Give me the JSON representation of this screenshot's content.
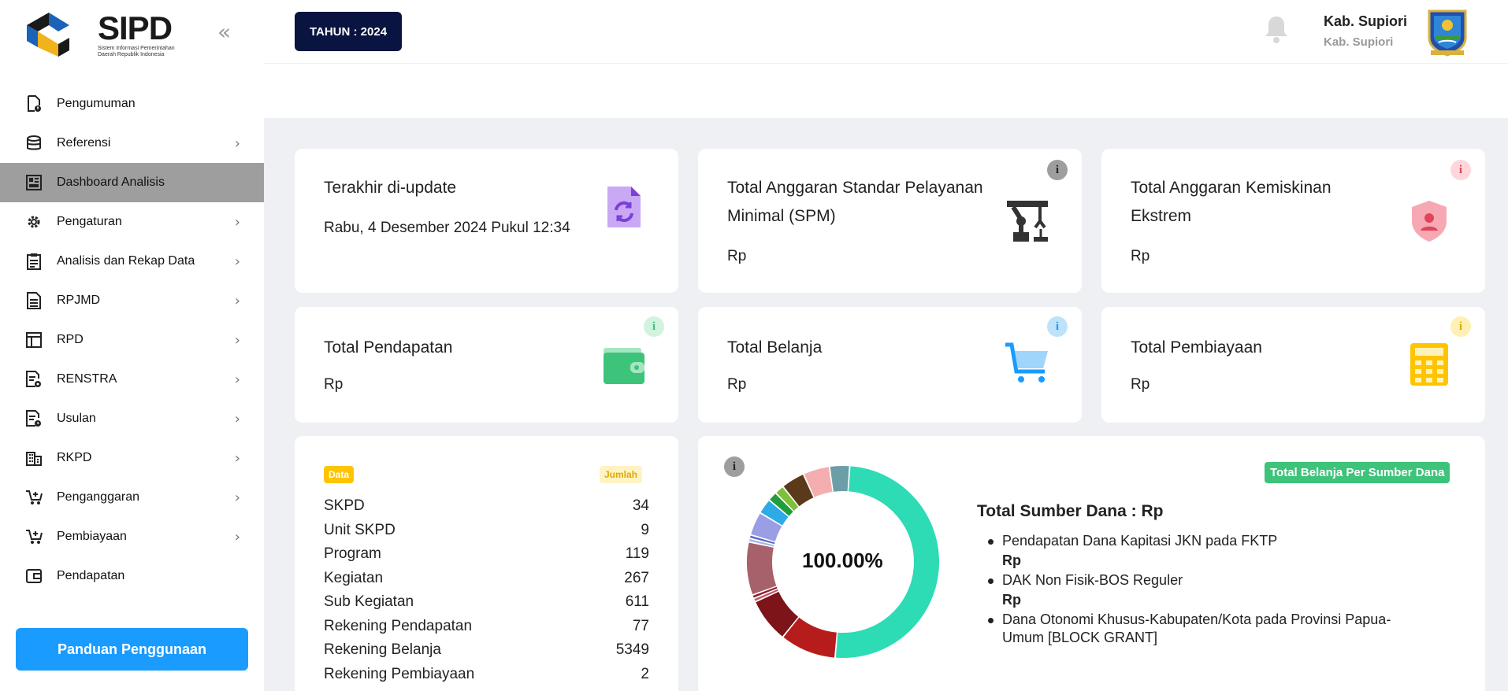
{
  "sidebar": {
    "logo_text": "SIPD",
    "logo_subtitle": "Sistem Informasi Pemerintahan Daerah Republik Indonesia",
    "items": [
      {
        "label": "Pengumuman",
        "icon": "announcement-icon",
        "has_children": false,
        "active": false
      },
      {
        "label": "Referensi",
        "icon": "database-icon",
        "has_children": true,
        "active": false
      },
      {
        "label": "Dashboard Analisis",
        "icon": "dashboard-icon",
        "has_children": false,
        "active": true
      },
      {
        "label": "Pengaturan",
        "icon": "gear-icon",
        "has_children": true,
        "active": false
      },
      {
        "label": "Analisis dan Rekap Data",
        "icon": "clipboard-icon",
        "has_children": true,
        "active": false
      },
      {
        "label": "RPJMD",
        "icon": "document-icon",
        "has_children": true,
        "active": false
      },
      {
        "label": "RPD",
        "icon": "table-icon",
        "has_children": true,
        "active": false
      },
      {
        "label": "RENSTRA",
        "icon": "doc-gear-icon",
        "has_children": true,
        "active": false
      },
      {
        "label": "Usulan",
        "icon": "doc-clock-icon",
        "has_children": true,
        "active": false
      },
      {
        "label": "RKPD",
        "icon": "building-icon",
        "has_children": true,
        "active": false
      },
      {
        "label": "Penganggaran",
        "icon": "cart-plus-icon",
        "has_children": true,
        "active": false
      },
      {
        "label": "Pembiayaan",
        "icon": "cart-plus-icon",
        "has_children": true,
        "active": false
      },
      {
        "label": "Pendapatan",
        "icon": "wallet-icon",
        "has_children": false,
        "active": false
      }
    ],
    "guide_button": "Panduan Penggunaan"
  },
  "header": {
    "year_button": "TAHUN : 2024",
    "user_name": "Kab. Supiori",
    "user_sub": "Kab. Supiori"
  },
  "cards": {
    "update": {
      "title": "Terakhir di-update",
      "value": "Rabu, 4 Desember 2024 Pukul 12:34"
    },
    "spm": {
      "title": "Total Anggaran Standar Pelayanan Minimal (SPM)",
      "value": "Rp"
    },
    "kemiskinan": {
      "title": "Total Anggaran Kemiskinan Ekstrem",
      "value": "Rp"
    },
    "pendapatan": {
      "title": "Total Pendapatan",
      "value": "Rp"
    },
    "belanja": {
      "title": "Total Belanja",
      "value": "Rp"
    },
    "pembiayaan": {
      "title": "Total Pembiayaan",
      "value": "Rp"
    },
    "info": "i"
  },
  "data_table": {
    "tag_data": "Data",
    "tag_jumlah": "Jumlah",
    "rows": [
      {
        "label": "SKPD",
        "value": "34"
      },
      {
        "label": "Unit SKPD",
        "value": "9"
      },
      {
        "label": "Program",
        "value": "119"
      },
      {
        "label": "Kegiatan",
        "value": "267"
      },
      {
        "label": "Sub Kegiatan",
        "value": "611"
      },
      {
        "label": "Rekening Pendapatan",
        "value": "77"
      },
      {
        "label": "Rekening Belanja",
        "value": "5349"
      },
      {
        "label": "Rekening Pembiayaan",
        "value": "2"
      }
    ]
  },
  "sumber_dana": {
    "badge": "Total Belanja Per Sumber Dana",
    "title": "Total Sumber Dana : Rp",
    "center_label": "100.00%",
    "items": [
      {
        "name": "Pendapatan Dana Kapitasi JKN pada FKTP",
        "rp": "Rp"
      },
      {
        "name": "DAK Non Fisik-BOS Reguler",
        "rp": "Rp"
      },
      {
        "name": "Dana Otonomi Khusus-Kabupaten/Kota pada Provinsi Papua-Umum [BLOCK GRANT]",
        "rp": ""
      }
    ]
  },
  "chart_data": {
    "type": "pie",
    "title": "",
    "center_label": "100.00%",
    "slices": [
      {
        "color": "#2ddbb5",
        "value": 50.5
      },
      {
        "color": "#b71c1c",
        "value": 9.5
      },
      {
        "color": "#7d1419",
        "value": 7.5
      },
      {
        "color": "#c2566e",
        "value": 0.6
      },
      {
        "color": "#8c1f2a",
        "value": 0.6
      },
      {
        "color": "#a6616a",
        "value": 9.0
      },
      {
        "color": "#aab4e6",
        "value": 0.6
      },
      {
        "color": "#5968c8",
        "value": 0.6
      },
      {
        "color": "#9a9ee4",
        "value": 4.0
      },
      {
        "color": "#2eaae6",
        "value": 2.6
      },
      {
        "color": "#1f9e3a",
        "value": 1.6
      },
      {
        "color": "#7ec03b",
        "value": 1.6
      },
      {
        "color": "#5b3a1a",
        "value": 4.0
      },
      {
        "color": "#f4aeb0",
        "value": 4.5
      },
      {
        "color": "#6b9ea6",
        "value": 3.4
      }
    ]
  }
}
